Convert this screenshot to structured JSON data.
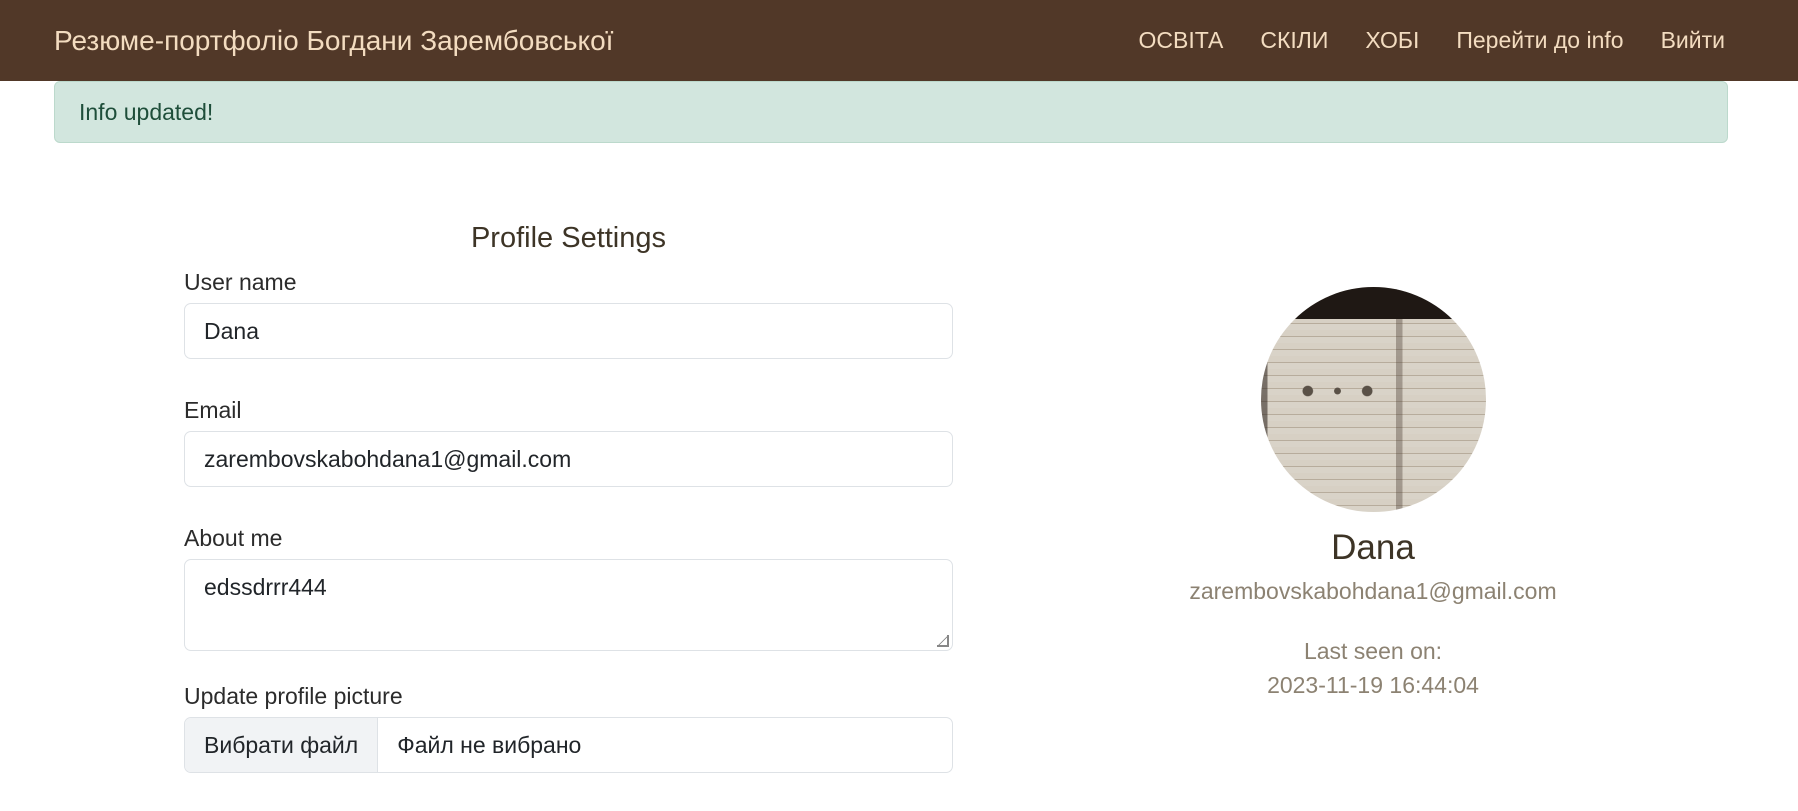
{
  "navbar": {
    "brand": "Резюме-портфоліо Богдани Зарембовської",
    "links": [
      "ОСВІТА",
      "СКІЛИ",
      "ХОБІ",
      "Перейти до info",
      "Вийти"
    ]
  },
  "alert": {
    "message": "Info updated!"
  },
  "form": {
    "title": "Profile Settings",
    "username_label": "User name",
    "username_value": "Dana",
    "email_label": "Email",
    "email_value": "zarembovskabohdana1@gmail.com",
    "about_label": "About me",
    "about_value": "edssdrrr444",
    "picture_label": "Update profile picture",
    "file_button": "Вибрати файл",
    "file_status": "Файл не вибрано"
  },
  "profile": {
    "name": "Dana",
    "email": "zarembovskabohdana1@gmail.com",
    "last_seen_label": "Last seen on:",
    "last_seen_value": "2023-11-19 16:44:04"
  },
  "colors": {
    "navbar": "#513828",
    "nav_text": "#f3dcc0",
    "alert_bg": "#d2e6de",
    "muted_text": "#8c8272"
  }
}
